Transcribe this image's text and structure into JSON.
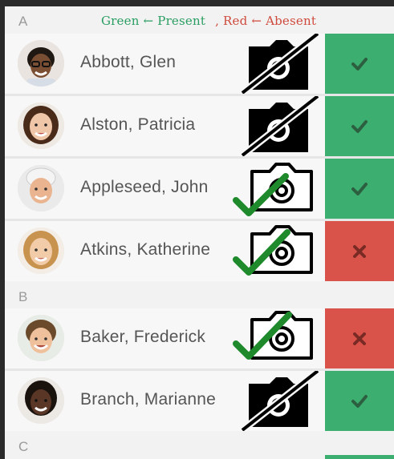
{
  "legend": {
    "present": "Green ← Present",
    "absent": ", Red ← Abesent"
  },
  "colors": {
    "present": "#3cae6f",
    "absent": "#d9534a",
    "legend_green": "#2a9e62",
    "legend_red": "#cf4a3c"
  },
  "sections": [
    {
      "letter": "A",
      "people": [
        {
          "name": "Abbott, Glen",
          "camera": "camera-off-icon",
          "photo_taken": false,
          "status": "present",
          "status_icon": "checkmark-icon"
        },
        {
          "name": "Alston, Patricia",
          "camera": "camera-off-icon",
          "photo_taken": false,
          "status": "present",
          "status_icon": "checkmark-icon"
        },
        {
          "name": "Appleseed, John",
          "camera": "camera-icon",
          "photo_taken": true,
          "status": "present",
          "status_icon": "checkmark-icon"
        },
        {
          "name": "Atkins, Katherine",
          "camera": "camera-icon",
          "photo_taken": true,
          "status": "absent",
          "status_icon": "cross-icon"
        }
      ]
    },
    {
      "letter": "B",
      "people": [
        {
          "name": "Baker, Frederick",
          "camera": "camera-icon",
          "photo_taken": true,
          "status": "absent",
          "status_icon": "cross-icon"
        },
        {
          "name": "Branch, Marianne",
          "camera": "camera-off-icon",
          "photo_taken": false,
          "status": "present",
          "status_icon": "checkmark-icon"
        }
      ]
    },
    {
      "letter": "C",
      "people": []
    }
  ]
}
